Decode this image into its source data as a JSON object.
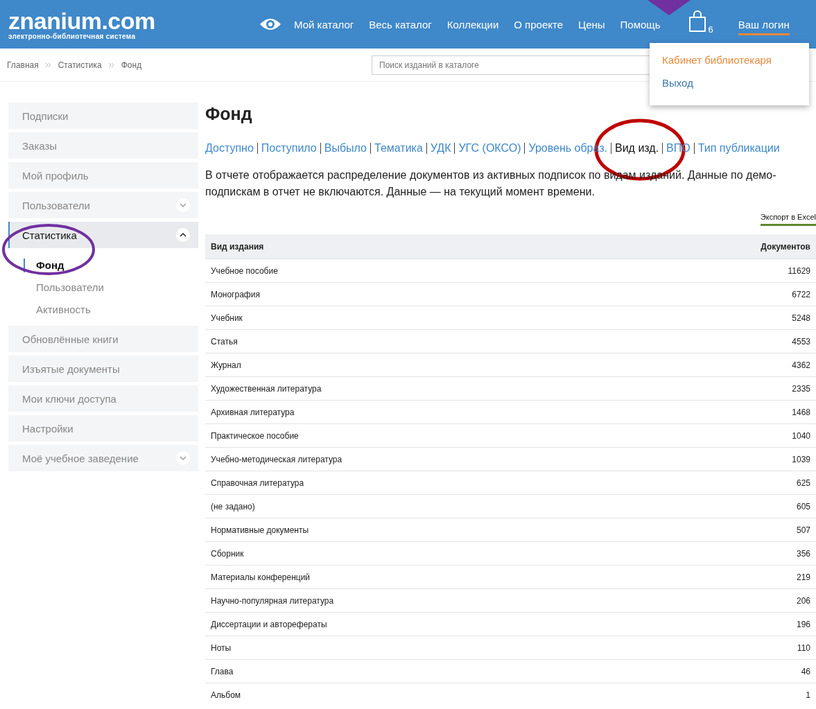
{
  "header": {
    "logo": "znanium.com",
    "tagline": "электронно-библиотечная система",
    "nav": [
      "Мой каталог",
      "Весь каталог",
      "Коллекции",
      "О проекте",
      "Цены",
      "Помощь"
    ],
    "cart_count": "6",
    "login": "Ваш логин"
  },
  "user_menu": [
    {
      "label": "Кабинет библиотекаря",
      "selected": true
    },
    {
      "label": "Выход",
      "selected": false
    }
  ],
  "breadcrumbs": [
    "Главная",
    "Статистика",
    "Фонд"
  ],
  "search": {
    "placeholder": "Поиск изданий в каталоге"
  },
  "sidebar": {
    "items": [
      {
        "label": "Подписки",
        "selected": false
      },
      {
        "label": "Заказы",
        "selected": false
      },
      {
        "label": "Мой профиль",
        "selected": false
      },
      {
        "label": "Пользователи",
        "selected": false,
        "expanded": false
      },
      {
        "label": "Статистика",
        "selected": true,
        "expanded": true,
        "children": [
          {
            "label": "Фонд",
            "selected": true
          },
          {
            "label": "Пользователи",
            "selected": false
          },
          {
            "label": "Активность",
            "selected": false
          }
        ]
      },
      {
        "label": "Обновлённые книги",
        "selected": false
      },
      {
        "label": "Изъятые документы",
        "selected": false
      },
      {
        "label": "Мои ключи доступа",
        "selected": false
      },
      {
        "label": "Настройки",
        "selected": false
      },
      {
        "label": "Моё учебное заведение",
        "selected": false,
        "expanded": false
      }
    ]
  },
  "title": "Фонд",
  "tabs": [
    {
      "label": "Доступно",
      "selected": false
    },
    {
      "label": "Поступило",
      "selected": false
    },
    {
      "label": "Выбыло",
      "selected": false
    },
    {
      "label": "Тематика",
      "selected": false
    },
    {
      "label": "УДК",
      "selected": false
    },
    {
      "label": "УГС (ОКСО)",
      "selected": false
    },
    {
      "label": "Уровень образ.",
      "selected": false
    },
    {
      "label": "Вид изд.",
      "selected": true
    },
    {
      "label": "ВПО",
      "selected": false
    },
    {
      "label": "Тип публикации",
      "selected": false
    }
  ],
  "description": "В отчете отображается распределение документов из активных подписок по видам изданий. Данные по демо-подпискам в отчет не включаются. Данные — на текущий момент времени.",
  "export": "Экспорт в Excel",
  "table": {
    "columns": [
      "Вид издания",
      "Документов"
    ],
    "rows": [
      [
        "Учебное пособие",
        "11629"
      ],
      [
        "Монография",
        "6722"
      ],
      [
        "Учебник",
        "5248"
      ],
      [
        "Статья",
        "4553"
      ],
      [
        "Журнал",
        "4362"
      ],
      [
        "Художественная литература",
        "2335"
      ],
      [
        "Архивная литература",
        "1468"
      ],
      [
        "Практическое пособие",
        "1040"
      ],
      [
        "Учебно-методическая литература",
        "1039"
      ],
      [
        "Справочная литература",
        "625"
      ],
      [
        "(не задано)",
        "605"
      ],
      [
        "Нормативные документы",
        "507"
      ],
      [
        "Сборник",
        "356"
      ],
      [
        "Материалы конференций",
        "219"
      ],
      [
        "Научно-популярная литература",
        "206"
      ],
      [
        "Диссертации и авторефераты",
        "196"
      ],
      [
        "Ноты",
        "110"
      ],
      [
        "Глава",
        "46"
      ],
      [
        "Альбом",
        "1"
      ]
    ]
  }
}
